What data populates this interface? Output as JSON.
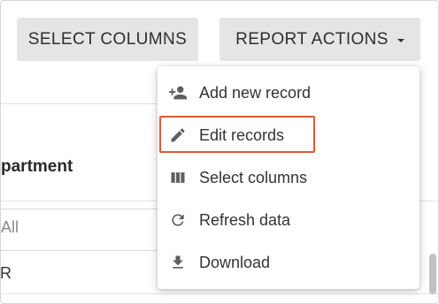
{
  "toolbar": {
    "select_columns_label": "SELECT COLUMNS",
    "report_actions_label": "REPORT ACTIONS"
  },
  "table": {
    "column_header_partial": "partment",
    "filter_placeholder_partial": "All",
    "first_row_partial": "R"
  },
  "menu": {
    "items": [
      {
        "label": "Add new record",
        "icon": "add-person-icon"
      },
      {
        "label": "Edit records",
        "icon": "pencil-icon",
        "highlighted": true
      },
      {
        "label": "Select columns",
        "icon": "columns-icon"
      },
      {
        "label": "Refresh data",
        "icon": "refresh-icon"
      },
      {
        "label": "Download",
        "icon": "download-icon"
      }
    ]
  },
  "colors": {
    "highlight_border": "#e0583a",
    "button_bg": "#e5e5e5",
    "icon_color": "#5f5f5f"
  }
}
